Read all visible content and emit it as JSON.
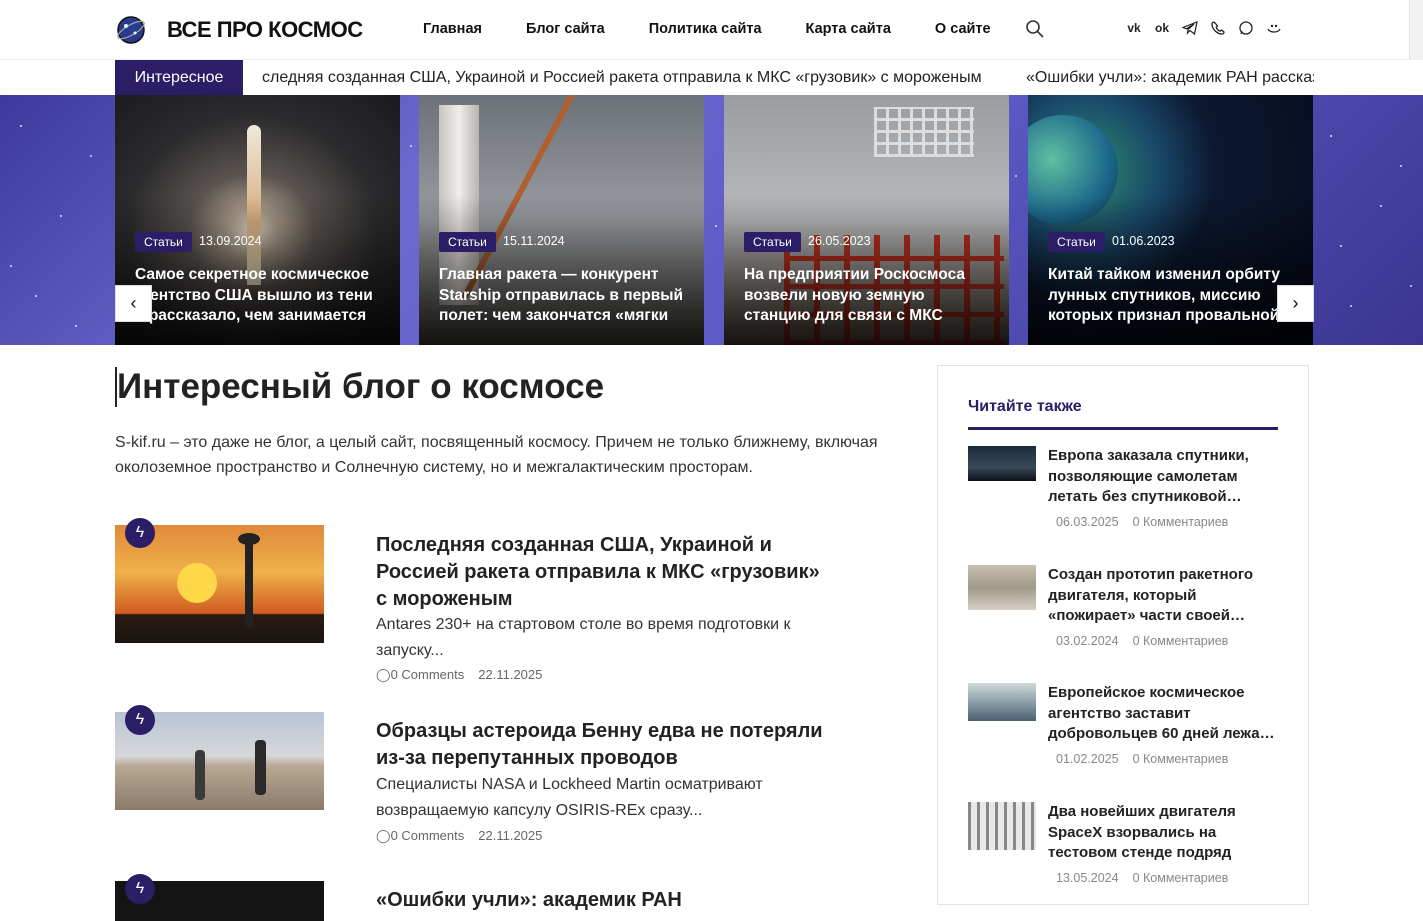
{
  "header": {
    "logo_text": "ВСЕ ПРО КОСМОС",
    "nav": [
      "Главная",
      "Блог сайта",
      "Политика сайта",
      "Карта сайта",
      "О сайте"
    ],
    "socials": [
      "vk-icon",
      "ok-icon",
      "telegram-icon",
      "viber-icon",
      "whatsapp-icon",
      "vk-video-icon"
    ]
  },
  "ticker": {
    "label": "Интересное",
    "items": [
      "следняя созданная США, Украиной и Россией ракета отправила к МКС «грузовик» с мороженым",
      "«Ошибки учли»: академик РАН рассказ"
    ]
  },
  "slider": {
    "slides": [
      {
        "category": "Статьи",
        "date": "13.09.2024",
        "title": "Самое секретное космическое агентство США вышло из тени и рассказало, чем занимается"
      },
      {
        "category": "Статьи",
        "date": "15.11.2024",
        "title": "Главная ракета — конкурент Starship отправилась в первый полет: чем закончатся «мягки"
      },
      {
        "category": "Статьи",
        "date": "26.05.2023",
        "title": "На предприятии Роскосмоса возвели новую земную станцию для связи с МКС"
      },
      {
        "category": "Статьи",
        "date": "01.06.2023",
        "title": "Китай тайком изменил орбиту лунных спутников, миссию которых признал провальной"
      }
    ],
    "prev": "‹",
    "next": "›"
  },
  "main": {
    "title": "Интересный блог о космосе",
    "intro": "S-kif.ru – это даже не блог, а целый сайт, посвященный космосу. Причем не только ближнему, включая околоземное пространство и Солнечную систему, но и межгалактическим просторам.",
    "posts": [
      {
        "title": "Последняя созданная США, Украиной и Россией ракета отправила к МКС «грузовик» с мороженым",
        "excerpt": "Antares 230+ на стартовом столе во время подготовки к запуску...",
        "comments": "0 Comments",
        "date": "22.11.2025"
      },
      {
        "title": "Образцы астероида Бенну едва не потеряли из-за перепутанных проводов",
        "excerpt": "Специалисты NASA и Lockheed Martin осматривают возвращаемую капсулу OSIRIS-REx сразу...",
        "comments": "0 Comments",
        "date": "22.11.2025"
      },
      {
        "title": "«Ошибки учли»: академик РАН",
        "excerpt": "",
        "comments": "",
        "date": ""
      }
    ]
  },
  "sidebar": {
    "title": "Читайте также",
    "items": [
      {
        "title": "Европа заказала спутники, позволяющие самолетам летать без спутниковой…",
        "date": "06.03.2025",
        "comments": "0 Комментариев"
      },
      {
        "title": "Создан прототип ракетного двигателя, который «пожирает» части своей…",
        "date": "03.02.2024",
        "comments": "0 Комментариев"
      },
      {
        "title": "Европейское космическое агентство заставит добровольцев 60 дней лежа…",
        "date": "01.02.2025",
        "comments": "0 Комментариев"
      },
      {
        "title": "Два новейших двигателя SpaceX взорвались на тестовом стенде подряд",
        "date": "13.05.2024",
        "comments": "0 Комментариев"
      }
    ]
  },
  "colors": {
    "accent": "#2b1e66",
    "slider_bg": "#5b59c4"
  }
}
